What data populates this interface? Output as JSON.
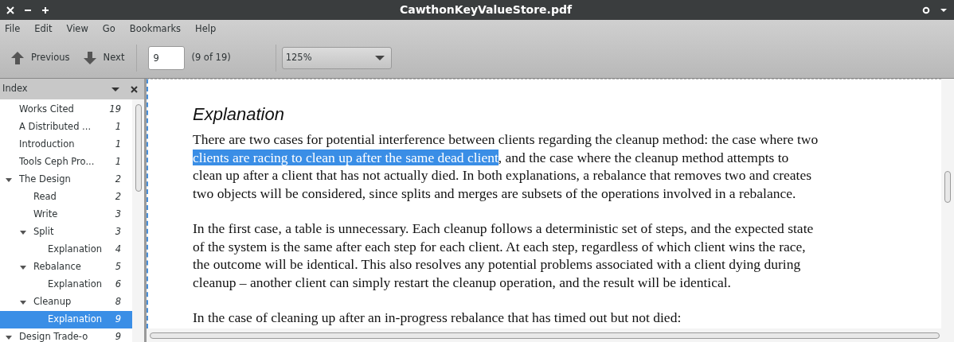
{
  "window": {
    "title": "CawthonKeyValueStore.pdf"
  },
  "menu": [
    "File",
    "Edit",
    "View",
    "Go",
    "Bookmarks",
    "Help"
  ],
  "toolbar": {
    "previous": "Previous",
    "next": "Next",
    "page_value": "9",
    "page_count": "(9 of 19)",
    "zoom": "125%"
  },
  "sidebar": {
    "title": "Index",
    "items": [
      {
        "title": "Works Cited",
        "page": "19",
        "selected": false
      },
      {
        "title": "A Distributed ...",
        "page": "1",
        "selected": false
      },
      {
        "title": "Introduction",
        "page": "1",
        "selected": false
      },
      {
        "title": "Tools Ceph Pro...",
        "page": "1",
        "selected": false
      },
      {
        "title": "The Design",
        "page": "2",
        "selected": false,
        "expanded": true,
        "children": [
          {
            "title": "Read",
            "page": "2",
            "selected": false
          },
          {
            "title": "Write",
            "page": "3",
            "selected": false
          },
          {
            "title": "Split",
            "page": "3",
            "selected": false,
            "expanded": true,
            "children": [
              {
                "title": "Explanation",
                "page": "4",
                "selected": false
              }
            ]
          },
          {
            "title": "Rebalance",
            "page": "5",
            "selected": false,
            "expanded": true,
            "children": [
              {
                "title": "Explanation",
                "page": "6",
                "selected": false
              }
            ]
          },
          {
            "title": "Cleanup",
            "page": "8",
            "selected": false,
            "expanded": true,
            "children": [
              {
                "title": "Explanation",
                "page": "9",
                "selected": true
              }
            ]
          }
        ]
      },
      {
        "title": "Design Trade-o",
        "page": "9",
        "selected": false,
        "expanded": true
      }
    ]
  },
  "document": {
    "heading": "Explanation",
    "paragraphs": [
      {
        "lines": [
          [
            {
              "text": "There are two cases for potential interference between clients regarding the cleanup method: the case where two",
              "selected": false
            }
          ],
          [
            {
              "text": "clients are racing to clean up after the same dead client",
              "selected": true
            },
            {
              "text": ", and the case where the cleanup method attempts to",
              "selected": false
            }
          ],
          [
            {
              "text": "clean up after a client that has not actually died. In both explanations, a rebalance that removes two and creates",
              "selected": false
            }
          ],
          [
            {
              "text": "two objects will be considered, since splits and merges are subsets of the operations involved in a rebalance.",
              "selected": false
            }
          ]
        ]
      },
      {
        "lines": [
          [
            {
              "text": "In the first case, a table is unnecessary. Each cleanup follows a deterministic set of steps, and the expected state",
              "selected": false
            }
          ],
          [
            {
              "text": "of the system is the same after each step for each client. At each step, regardless of which client wins the race,",
              "selected": false
            }
          ],
          [
            {
              "text": "the outcome will be identical. This also resolves any potential problems associated with a client dying during",
              "selected": false
            }
          ],
          [
            {
              "text": "cleanup – another client can simply restart the cleanup operation, and the result will be identical.",
              "selected": false
            }
          ]
        ]
      },
      {
        "lines": [
          [
            {
              "text": "In the case of cleaning up after an in-progress rebalance that has timed out but not died:",
              "selected": false
            }
          ]
        ]
      }
    ]
  }
}
